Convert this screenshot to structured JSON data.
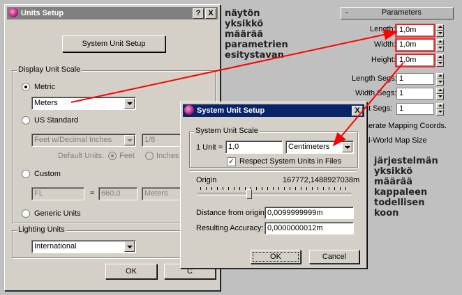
{
  "units_setup": {
    "title": "Units Setup",
    "help_btn": "?",
    "close_btn": "X",
    "system_unit_setup_btn": "System Unit Setup",
    "display_group": "Display Unit Scale",
    "metric_label": "Metric",
    "metric_value": "Meters",
    "us_label": "US Standard",
    "us_value": "Feet w/Decimal Inches",
    "us_fraction": "1/8",
    "default_units_label": "Default Units:",
    "feet_label": "Feet",
    "inches_label": "Inches",
    "custom_label": "Custom",
    "custom_name": "FL",
    "custom_eq": "=",
    "custom_value": "660,0",
    "custom_unit": "Meters",
    "generic_label": "Generic Units",
    "lighting_group": "Lighting Units",
    "lighting_value": "International",
    "ok": "OK",
    "cancel": "C"
  },
  "parameters": {
    "header": "Parameters",
    "collapse": "-",
    "length_label": "Length:",
    "length_value": "1,0m",
    "width_label": "Width:",
    "width_value": "1,0m",
    "height_label": "Height:",
    "height_value": "1,0m",
    "length_segs_label": "Length Segs:",
    "length_segs_value": "1",
    "width_segs_label": "Width Segs:",
    "width_segs_value": "1",
    "height_segs_label": "nt Segs:",
    "height_segs_value": "1",
    "gen_mapping": "nerate Mapping Coords.",
    "real_world": "al-World Map Size"
  },
  "system_unit_setup": {
    "title": "System Unit Setup",
    "close_btn": "X",
    "scale_group": "System Unit Scale",
    "unit_prefix": "1 Unit =",
    "unit_value": "1,0",
    "unit_type": "Centimeters",
    "respect_label": "Respect System Units in Files",
    "respect_checked": true,
    "origin_label": "Origin",
    "origin_value": "167772,1488927038m",
    "distance_label": "Distance from origin:",
    "distance_value": "0,0099999999m",
    "accuracy_label": "Resulting Accuracy:",
    "accuracy_value": "0,0000000012m",
    "ok": "OK",
    "cancel": "Cancel"
  },
  "annotations": {
    "top": [
      "näytön",
      "yksikkö",
      "määrää",
      "parametrien",
      "esitystavan"
    ],
    "bottom": [
      "järjestelmän",
      "yksikkö",
      "määrää",
      "kappaleen",
      "todellisen",
      "koon"
    ]
  },
  "colors": {
    "title_active": "#0a246a",
    "title_inactive": "#808080",
    "arrow": "#ff0000"
  }
}
